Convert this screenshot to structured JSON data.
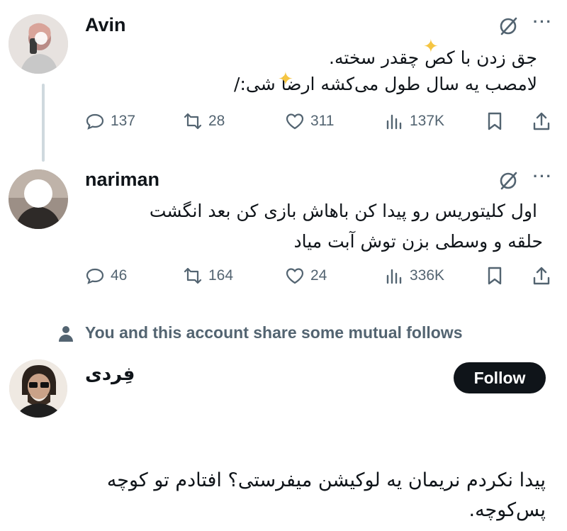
{
  "tweets": [
    {
      "name": "Avin",
      "lines": [
        "جق زدن با کص چقدر سخته.",
        "لامصب یه سال طول می‌کشه ارضا شی:/"
      ],
      "replies": "137",
      "reposts": "28",
      "likes": "311",
      "views": "137K"
    },
    {
      "name": "nariman",
      "lines": [
        "اول کلیتوریس رو پیدا کن باهاش بازی کن بعد انگشت",
        "حلقه و وسطی بزن توش آبت میاد"
      ],
      "replies": "46",
      "reposts": "164",
      "likes": "24",
      "views": "336K"
    }
  ],
  "mutual_notice": "You and this account share some mutual follows",
  "profile": {
    "name": "فِردی",
    "follow_label": "Follow"
  },
  "final_post": {
    "lines": [
      "پیدا نکردم نریمان یه لوکیشن میفرستی؟ افتادم تو کوچه",
      "پس‌کوچه."
    ]
  },
  "icons": {
    "more": "more-icon",
    "grok": "grok-icon",
    "reply": "reply-icon",
    "repost": "repost-icon",
    "like": "like-icon",
    "views": "views-icon",
    "bookmark": "bookmark-icon",
    "share": "share-icon",
    "person": "person-icon"
  },
  "colors": {
    "text": "#0f1419",
    "muted": "#536471",
    "thread_line": "#cfd9de",
    "follow_bg": "#0f1419",
    "sparkle": "#f5c542"
  }
}
